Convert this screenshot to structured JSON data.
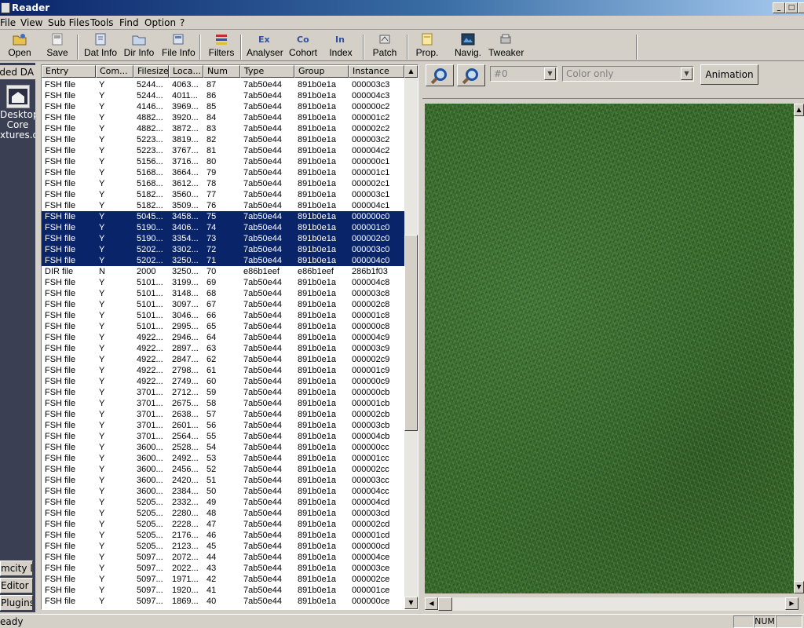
{
  "window": {
    "title": "Reader"
  },
  "menu": [
    "File",
    "View",
    "Sub Files",
    "Tools",
    "Find",
    "Option",
    "?"
  ],
  "toolbar": [
    {
      "label": "Open",
      "icon": "folder-open-icon"
    },
    {
      "label": "Save",
      "icon": "save-icon"
    },
    {
      "label": "Dat Info",
      "icon": "dat-info-icon"
    },
    {
      "label": "Dir Info",
      "icon": "dir-info-icon"
    },
    {
      "label": "File Info",
      "icon": "file-info-icon"
    },
    {
      "label": "Filters",
      "icon": "filters-icon"
    },
    {
      "label": "Analyser",
      "icon": "analyser-icon"
    },
    {
      "label": "Cohort",
      "icon": "cohort-icon"
    },
    {
      "label": "Index",
      "icon": "index-icon"
    },
    {
      "label": "Patch",
      "icon": "patch-icon"
    },
    {
      "label": "Prop.",
      "icon": "properties-icon"
    },
    {
      "label": "Navig.",
      "icon": "navigator-icon"
    },
    {
      "label": "Tweaker",
      "icon": "tweaker-icon"
    }
  ],
  "left_panel": {
    "header": "aded DA",
    "dat_item_lines": [
      "Desktop\\",
      "Core",
      "xtures.da"
    ],
    "buttons": [
      "mcity DA",
      "Editor DA",
      "Plugins"
    ]
  },
  "list": {
    "columns": [
      "Entry",
      "Com...",
      "Filesize",
      "Loca...",
      "Num",
      "Type",
      "Group",
      "Instance"
    ],
    "rows": [
      [
        "FSH file",
        "Y",
        "5244...",
        "4063...",
        "87",
        "7ab50e44",
        "891b0e1a",
        "000003c3"
      ],
      [
        "FSH file",
        "Y",
        "5244...",
        "4011...",
        "86",
        "7ab50e44",
        "891b0e1a",
        "000004c3"
      ],
      [
        "FSH file",
        "Y",
        "4146...",
        "3969...",
        "85",
        "7ab50e44",
        "891b0e1a",
        "000000c2"
      ],
      [
        "FSH file",
        "Y",
        "4882...",
        "3920...",
        "84",
        "7ab50e44",
        "891b0e1a",
        "000001c2"
      ],
      [
        "FSH file",
        "Y",
        "4882...",
        "3872...",
        "83",
        "7ab50e44",
        "891b0e1a",
        "000002c2"
      ],
      [
        "FSH file",
        "Y",
        "5223...",
        "3819...",
        "82",
        "7ab50e44",
        "891b0e1a",
        "000003c2"
      ],
      [
        "FSH file",
        "Y",
        "5223...",
        "3767...",
        "81",
        "7ab50e44",
        "891b0e1a",
        "000004c2"
      ],
      [
        "FSH file",
        "Y",
        "5156...",
        "3716...",
        "80",
        "7ab50e44",
        "891b0e1a",
        "000000c1"
      ],
      [
        "FSH file",
        "Y",
        "5168...",
        "3664...",
        "79",
        "7ab50e44",
        "891b0e1a",
        "000001c1"
      ],
      [
        "FSH file",
        "Y",
        "5168...",
        "3612...",
        "78",
        "7ab50e44",
        "891b0e1a",
        "000002c1"
      ],
      [
        "FSH file",
        "Y",
        "5182...",
        "3560...",
        "77",
        "7ab50e44",
        "891b0e1a",
        "000003c1"
      ],
      [
        "FSH file",
        "Y",
        "5182...",
        "3509...",
        "76",
        "7ab50e44",
        "891b0e1a",
        "000004c1"
      ],
      [
        "FSH file",
        "Y",
        "5045...",
        "3458...",
        "75",
        "7ab50e44",
        "891b0e1a",
        "000000c0"
      ],
      [
        "FSH file",
        "Y",
        "5190...",
        "3406...",
        "74",
        "7ab50e44",
        "891b0e1a",
        "000001c0"
      ],
      [
        "FSH file",
        "Y",
        "5190...",
        "3354...",
        "73",
        "7ab50e44",
        "891b0e1a",
        "000002c0"
      ],
      [
        "FSH file",
        "Y",
        "5202...",
        "3302...",
        "72",
        "7ab50e44",
        "891b0e1a",
        "000003c0"
      ],
      [
        "FSH file",
        "Y",
        "5202...",
        "3250...",
        "71",
        "7ab50e44",
        "891b0e1a",
        "000004c0"
      ],
      [
        "DIR file",
        "N",
        "2000",
        "3250...",
        "70",
        "e86b1eef",
        "e86b1eef",
        "286b1f03"
      ],
      [
        "FSH file",
        "Y",
        "5101...",
        "3199...",
        "69",
        "7ab50e44",
        "891b0e1a",
        "000004c8"
      ],
      [
        "FSH file",
        "Y",
        "5101...",
        "3148...",
        "68",
        "7ab50e44",
        "891b0e1a",
        "000003c8"
      ],
      [
        "FSH file",
        "Y",
        "5101...",
        "3097...",
        "67",
        "7ab50e44",
        "891b0e1a",
        "000002c8"
      ],
      [
        "FSH file",
        "Y",
        "5101...",
        "3046...",
        "66",
        "7ab50e44",
        "891b0e1a",
        "000001c8"
      ],
      [
        "FSH file",
        "Y",
        "5101...",
        "2995...",
        "65",
        "7ab50e44",
        "891b0e1a",
        "000000c8"
      ],
      [
        "FSH file",
        "Y",
        "4922...",
        "2946...",
        "64",
        "7ab50e44",
        "891b0e1a",
        "000004c9"
      ],
      [
        "FSH file",
        "Y",
        "4922...",
        "2897...",
        "63",
        "7ab50e44",
        "891b0e1a",
        "000003c9"
      ],
      [
        "FSH file",
        "Y",
        "4922...",
        "2847...",
        "62",
        "7ab50e44",
        "891b0e1a",
        "000002c9"
      ],
      [
        "FSH file",
        "Y",
        "4922...",
        "2798...",
        "61",
        "7ab50e44",
        "891b0e1a",
        "000001c9"
      ],
      [
        "FSH file",
        "Y",
        "4922...",
        "2749...",
        "60",
        "7ab50e44",
        "891b0e1a",
        "000000c9"
      ],
      [
        "FSH file",
        "Y",
        "3701...",
        "2712...",
        "59",
        "7ab50e44",
        "891b0e1a",
        "000000cb"
      ],
      [
        "FSH file",
        "Y",
        "3701...",
        "2675...",
        "58",
        "7ab50e44",
        "891b0e1a",
        "000001cb"
      ],
      [
        "FSH file",
        "Y",
        "3701...",
        "2638...",
        "57",
        "7ab50e44",
        "891b0e1a",
        "000002cb"
      ],
      [
        "FSH file",
        "Y",
        "3701...",
        "2601...",
        "56",
        "7ab50e44",
        "891b0e1a",
        "000003cb"
      ],
      [
        "FSH file",
        "Y",
        "3701...",
        "2564...",
        "55",
        "7ab50e44",
        "891b0e1a",
        "000004cb"
      ],
      [
        "FSH file",
        "Y",
        "3600...",
        "2528...",
        "54",
        "7ab50e44",
        "891b0e1a",
        "000000cc"
      ],
      [
        "FSH file",
        "Y",
        "3600...",
        "2492...",
        "53",
        "7ab50e44",
        "891b0e1a",
        "000001cc"
      ],
      [
        "FSH file",
        "Y",
        "3600...",
        "2456...",
        "52",
        "7ab50e44",
        "891b0e1a",
        "000002cc"
      ],
      [
        "FSH file",
        "Y",
        "3600...",
        "2420...",
        "51",
        "7ab50e44",
        "891b0e1a",
        "000003cc"
      ],
      [
        "FSH file",
        "Y",
        "3600...",
        "2384...",
        "50",
        "7ab50e44",
        "891b0e1a",
        "000004cc"
      ],
      [
        "FSH file",
        "Y",
        "5205...",
        "2332...",
        "49",
        "7ab50e44",
        "891b0e1a",
        "000004cd"
      ],
      [
        "FSH file",
        "Y",
        "5205...",
        "2280...",
        "48",
        "7ab50e44",
        "891b0e1a",
        "000003cd"
      ],
      [
        "FSH file",
        "Y",
        "5205...",
        "2228...",
        "47",
        "7ab50e44",
        "891b0e1a",
        "000002cd"
      ],
      [
        "FSH file",
        "Y",
        "5205...",
        "2176...",
        "46",
        "7ab50e44",
        "891b0e1a",
        "000001cd"
      ],
      [
        "FSH file",
        "Y",
        "5205...",
        "2123...",
        "45",
        "7ab50e44",
        "891b0e1a",
        "000000cd"
      ],
      [
        "FSH file",
        "Y",
        "5097...",
        "2072...",
        "44",
        "7ab50e44",
        "891b0e1a",
        "000004ce"
      ],
      [
        "FSH file",
        "Y",
        "5097...",
        "2022...",
        "43",
        "7ab50e44",
        "891b0e1a",
        "000003ce"
      ],
      [
        "FSH file",
        "Y",
        "5097...",
        "1971...",
        "42",
        "7ab50e44",
        "891b0e1a",
        "000002ce"
      ],
      [
        "FSH file",
        "Y",
        "5097...",
        "1920...",
        "41",
        "7ab50e44",
        "891b0e1a",
        "000001ce"
      ],
      [
        "FSH file",
        "Y",
        "5097...",
        "1869...",
        "40",
        "7ab50e44",
        "891b0e1a",
        "000000ce"
      ]
    ],
    "selected_rows": [
      12,
      13,
      14,
      15,
      16
    ]
  },
  "preview": {
    "index_combo": "#0",
    "mode_combo": "Color only",
    "animation_label": "Animation"
  },
  "status": {
    "text": "eady",
    "num": "NUM"
  },
  "colors": {
    "selection": "#0a246a",
    "titlebar": "#0a246a",
    "grass": "#3a6b2e"
  }
}
